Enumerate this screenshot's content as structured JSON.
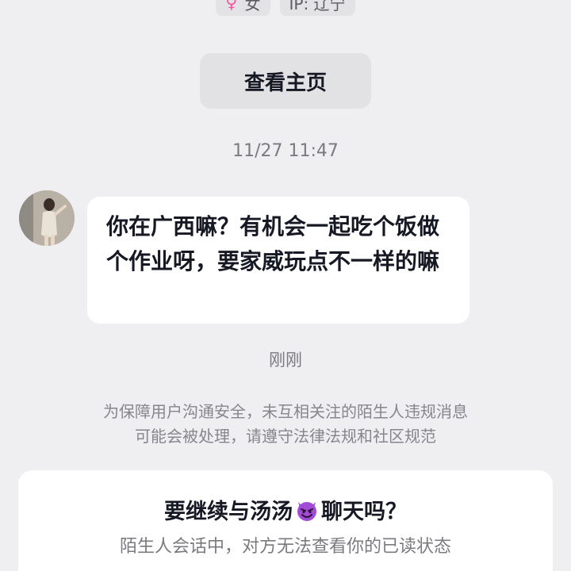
{
  "profile_tags": {
    "gender_icon": "female-symbol-icon",
    "gender": "女",
    "ip": "IP: 辽宁"
  },
  "view_homepage_button": "查看主页",
  "timestamp": "11/27 11:47",
  "message": {
    "avatar_icon": "user-avatar",
    "text": "你在广西嘛？有机会一起吃个饭做个作业呀，要家威玩点不一样的嘛"
  },
  "sent_time": "刚刚",
  "notice": {
    "line1": "为保障用户沟通安全，未互相关注的陌生人违规消息",
    "line2": "可能会被处理，请遵守法律法规和社区规范"
  },
  "prompt_card": {
    "title_prefix": "要继续与汤汤",
    "title_icon": "smiling-devil-emoji",
    "title_suffix": "聊天吗？",
    "subtitle": "陌生人会话中，对方无法查看你的已读状态"
  },
  "colors": {
    "background": "#efeff1",
    "bubble": "#ffffff",
    "primary_text": "#161823",
    "secondary_text": "#7a7a80",
    "gender_icon": "#ff4fa3",
    "devil_emoji": "#a24bd6"
  }
}
